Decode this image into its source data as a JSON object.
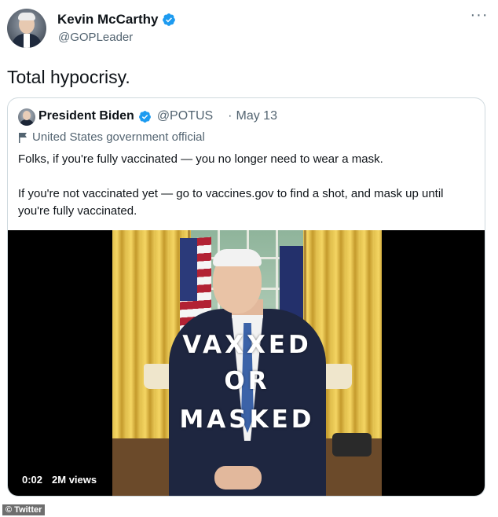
{
  "tweet": {
    "author_name": "Kevin McCarthy",
    "author_handle": "@GOPLeader",
    "more_glyph": "···",
    "text": "Total hypocrisy."
  },
  "quote": {
    "author_name": "President Biden",
    "author_handle": "@POTUS",
    "separator": "·",
    "date": "May 13",
    "gov_label": "United States government official",
    "text_line1": "Folks, if you're fully vaccinated — you no longer need to wear a mask.",
    "text_line2": "If you're not vaccinated yet — go to vaccines.gov to find a shot, and mask up until you're fully vaccinated.",
    "video": {
      "overlay_line1": "VAXXED",
      "overlay_line2": "OR",
      "overlay_line3": "MASKED",
      "duration": "0:02",
      "views": "2M views"
    }
  },
  "watermark": "© Twitter",
  "colors": {
    "verified": "#1d9bf0",
    "secondary_text": "#536471",
    "border": "#cfd9de"
  },
  "icons": [
    "verified-badge-icon",
    "more-options-icon",
    "flag-icon"
  ]
}
